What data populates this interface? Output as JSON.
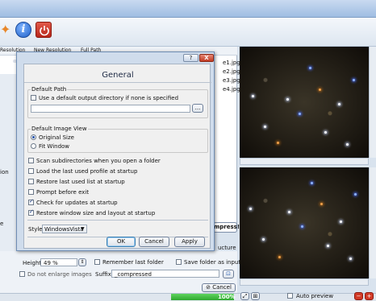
{
  "toolbar": {
    "icons": [
      "star-icon",
      "info-icon",
      "power-icon"
    ]
  },
  "file_list": {
    "columns": [
      "Resolution",
      "New Resolution",
      "Full Path"
    ],
    "files": [
      "e1.jpg",
      "e2.jpg",
      "e3.jpg",
      "e4.jpg"
    ]
  },
  "left_panel": {
    "labels": [
      "ion",
      "e"
    ]
  },
  "dialog": {
    "help_label": "?",
    "close_label": "X",
    "title": "General",
    "default_path": {
      "group_label": "Default Path",
      "use_default_label": "Use a default output directory if none is specified",
      "use_default_checked": false,
      "path_value": "",
      "browse_label": "..."
    },
    "default_view": {
      "group_label": "Default Image View",
      "options": [
        {
          "label": "Original Size",
          "checked": true
        },
        {
          "label": "Fit Window",
          "checked": false
        }
      ]
    },
    "options": [
      {
        "label": "Scan subdirectories when you open a folder",
        "checked": false
      },
      {
        "label": "Load the last used profile at startup",
        "checked": false
      },
      {
        "label": "Restore last used list at startup",
        "checked": false
      },
      {
        "label": "Prompt before exit",
        "checked": false
      },
      {
        "label": "Check for updates at startup",
        "checked": true
      },
      {
        "label": "Restore window size and layout at startup",
        "checked": true
      }
    ],
    "style_label": "Style",
    "style_value": "WindowsVista",
    "ok_label": "OK",
    "cancel_label": "Cancel",
    "apply_label": "Apply"
  },
  "bottom": {
    "compress_label": "mpress!",
    "structure_label": "ucture",
    "height_label": "Height:",
    "height_value": "49 %",
    "remember_label": "Remember last folder",
    "save_folder_label": "Save folder as input",
    "no_enlarge_label": "Do not enlarge images",
    "suffix_label": "Suffix:",
    "suffix_value": "_compressed",
    "cancel_label": "Cancel"
  },
  "status": {
    "progress_label": "100%",
    "progress_value": 1.0,
    "auto_preview_label": "Auto preview"
  }
}
